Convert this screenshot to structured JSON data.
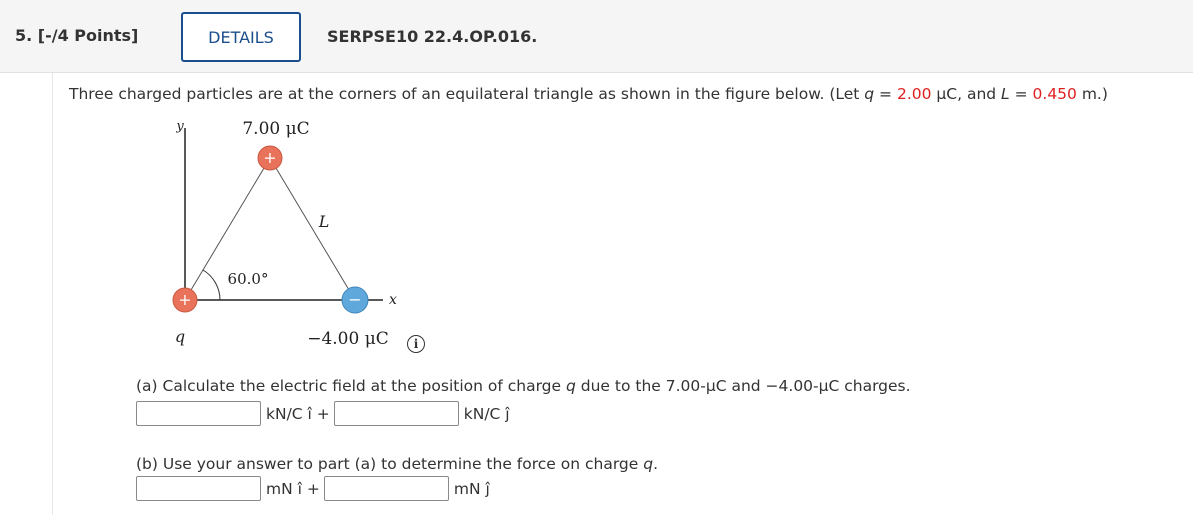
{
  "header": {
    "question_number": "5. [-/4 Points]",
    "details_label": "DETAILS",
    "question_code": "SERPSE10 22.4.OP.016."
  },
  "prompt": {
    "text_before": "Three charged particles are at the corners of an equilateral triangle as shown in the figure below. (Let ",
    "q_var": "q",
    "eq1": " = ",
    "q_value": "2.00",
    "q_unit": " μC, and ",
    "l_var": "L",
    "eq2": " = ",
    "l_value": "0.450",
    "l_unit": " m.)"
  },
  "figure": {
    "y_label": "y",
    "x_label": "x",
    "top_charge_label": "7.00 μC",
    "side_label": "L",
    "angle_label": "60.0°",
    "origin_charge_label": "q",
    "right_charge_label": "−4.00 μC",
    "positive_sign": "+",
    "negative_sign": "−",
    "positive_color": "#e8735a",
    "negative_color": "#5fa8dc"
  },
  "info_icon": "i",
  "part_a": {
    "text_before": "(a) Calculate the electric field at the position of charge ",
    "var": "q",
    "text_after": " due to the 7.00-μC and −4.00-μC charges.",
    "unit_i": "kN/C î +",
    "unit_j": "kN/C ĵ",
    "value_i": "",
    "value_j": ""
  },
  "part_b": {
    "text_before": "(b) Use your answer to part (a) to determine the force on charge ",
    "var": "q",
    "text_after": ".",
    "unit_i": "mN î +",
    "unit_j": "mN ĵ",
    "value_i": "",
    "value_j": ""
  },
  "colors": {
    "accent": "#1b4e8c",
    "highlight": "#e02020"
  }
}
